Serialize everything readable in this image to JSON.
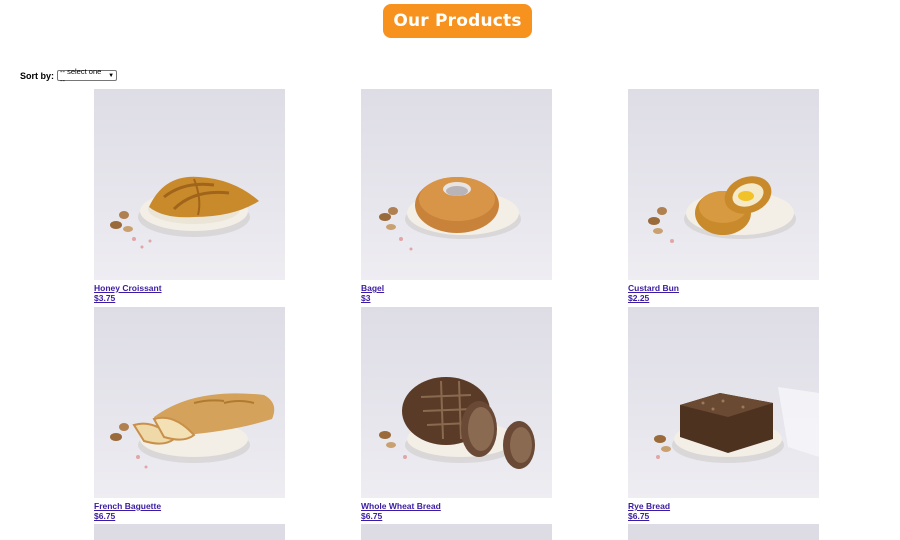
{
  "header": {
    "title": "Our Products"
  },
  "sort": {
    "label": "Sort by:",
    "selected": "-- select one --"
  },
  "products": [
    {
      "name": "Honey Croissant",
      "price": "$3.75",
      "icon": "croissant-photo"
    },
    {
      "name": "Bagel",
      "price": "$3",
      "icon": "bagel-photo"
    },
    {
      "name": "Custard Bun",
      "price": "$2.25",
      "icon": "custard-bun-photo"
    },
    {
      "name": "French Baguette",
      "price": "$6.75",
      "icon": "baguette-photo"
    },
    {
      "name": "Whole Wheat Bread",
      "price": "$6.75",
      "icon": "whole-wheat-bread-photo"
    },
    {
      "name": "Rye Bread",
      "price": "$6.75",
      "icon": "rye-bread-photo"
    }
  ],
  "colors": {
    "accent": "#f7921e",
    "link": "#3b1ba3"
  }
}
